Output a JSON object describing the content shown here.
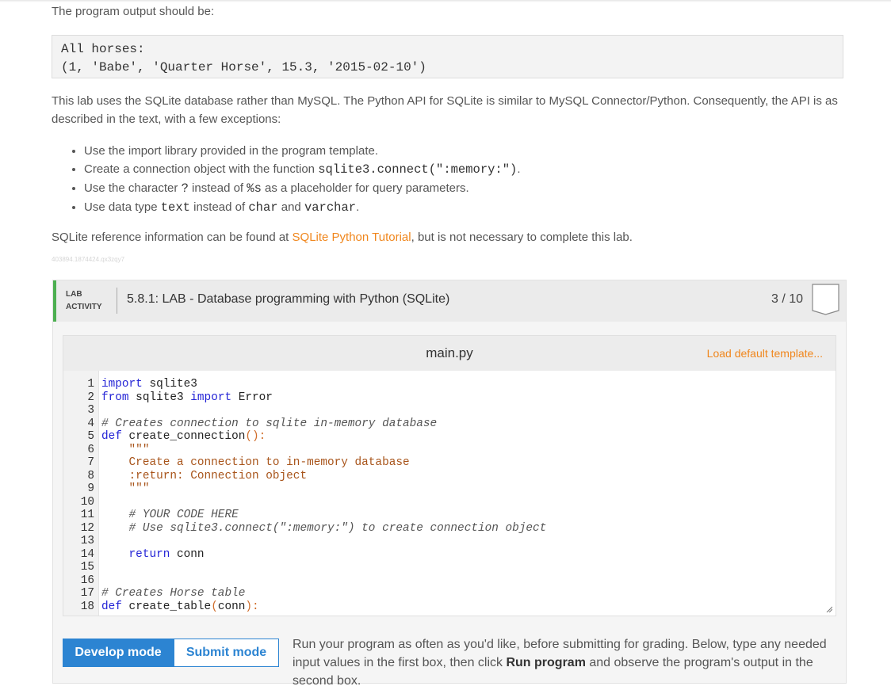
{
  "intro": "The program output should be:",
  "expected_output": [
    "All horses:",
    "(1, 'Babe', 'Quarter Horse', 15.3, '2015-02-10')"
  ],
  "paragraph1": "This lab uses the SQLite database rather than MySQL. The Python API for SQLite is similar to MySQL Connector/Python. Consequently, the API is as described in the text, with a few exceptions:",
  "bullets": {
    "b1": "Use the import library provided in the program template.",
    "b2_pre": "Create a connection object with the function ",
    "b2_code": "sqlite3.connect(\":memory:\")",
    "b2_post": ".",
    "b3_pre": "Use the character ",
    "b3_code1": "?",
    "b3_mid": " instead of ",
    "b3_code2": "%s",
    "b3_post": " as a placeholder for query parameters.",
    "b4_pre": "Use data type ",
    "b4_code1": "text",
    "b4_mid": " instead of ",
    "b4_code2": "char",
    "b4_and": " and ",
    "b4_code3": "varchar",
    "b4_post": "."
  },
  "reference": {
    "pre": "SQLite reference information can be found at ",
    "link": "SQLite Python Tutorial",
    "post": ", but is not necessary to complete this lab."
  },
  "tiny_id": "403894.1874424.qx3zqy7",
  "lab": {
    "tag_line1": "LAB",
    "tag_line2": "ACTIVITY",
    "title": "5.8.1: LAB - Database programming with Python (SQLite)",
    "score": "3 / 10"
  },
  "editor": {
    "filename": "main.py",
    "load_template": "Load default template...",
    "line_numbers": [
      "1",
      "2",
      "3",
      "4",
      "5",
      "6",
      "7",
      "8",
      "9",
      "10",
      "11",
      "12",
      "13",
      "14",
      "15",
      "16",
      "17",
      "18"
    ],
    "lines": [
      "import sqlite3",
      "from sqlite3 import Error",
      "",
      "# Creates connection to sqlite in-memory database",
      "def create_connection():",
      "    \"\"\"",
      "    Create a connection to in-memory database",
      "    :return: Connection object",
      "    \"\"\"",
      "",
      "    # YOUR CODE HERE",
      "    # Use sqlite3.connect(\":memory:\") to create connection object",
      "",
      "    return conn",
      "",
      "",
      "# Creates Horse table",
      "def create_table(conn):"
    ]
  },
  "modes": {
    "develop": "Develop mode",
    "submit": "Submit mode"
  },
  "run_text": {
    "pre": "Run your program as often as you'd like, before submitting for grading. Below, type any needed input values in the first box, then click ",
    "bold": "Run program",
    "post": " and observe the program's output in the second box."
  },
  "colors": {
    "accent_orange": "#f0861c",
    "accent_blue": "#2c84d2",
    "lab_green": "#4caf50",
    "keyword": "#2424d6"
  }
}
